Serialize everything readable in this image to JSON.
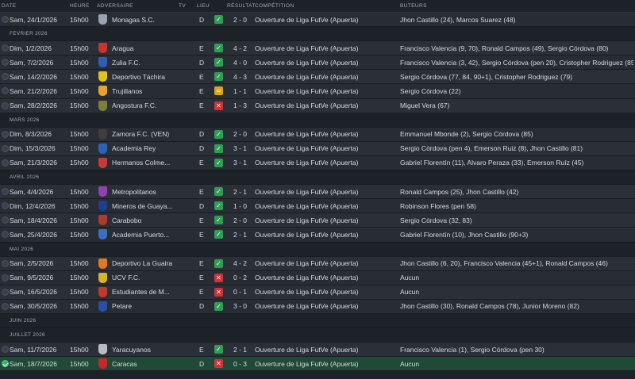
{
  "header": {
    "date": "DATE",
    "time": "HEURE",
    "opponent": "ADVERSAIRE",
    "tv": "TV",
    "venue": "LIEU",
    "result": "RÉSULTAT",
    "competition": "COMPÉTITION",
    "scorers": "BUTEURS"
  },
  "rows": [
    {
      "type": "match",
      "date": "Sam, 24/1/2026",
      "time": "15h00",
      "opponent": "Monagas S.C.",
      "crest_color": "#9aa3b0",
      "venue": "D",
      "result": "W",
      "score": "2 - 0",
      "competition": "Ouverture de Liga FutVe (Apuerta)",
      "scorers": "Jhon Castillo (24), Marcos Suarez (48)",
      "status": "past"
    },
    {
      "type": "month",
      "label": "FÉVRIER 2026"
    },
    {
      "type": "match",
      "date": "Dim, 1/2/2026",
      "time": "15h00",
      "opponent": "Aragua",
      "crest_color": "#c8342e",
      "venue": "E",
      "result": "W",
      "score": "4 - 2",
      "competition": "Ouverture de Liga FutVe (Apuerta)",
      "scorers": "Francisco Valencia (9, 70), Ronald Campos (49), Sergio Córdova (80)",
      "status": "past"
    },
    {
      "type": "match",
      "date": "Sam, 7/2/2026",
      "time": "15h00",
      "opponent": "Zulia F.C.",
      "crest_color": "#2f5fb0",
      "venue": "D",
      "result": "W",
      "score": "4 - 0",
      "competition": "Ouverture de Liga FutVe (Apuerta)",
      "scorers": "Francisco Valencia (3, 42), Sergio Córdova (pen 20), Cristopher Rodriguez (85)",
      "status": "past"
    },
    {
      "type": "match",
      "date": "Sam, 14/2/2026",
      "time": "15h00",
      "opponent": "Deportivo Táchira",
      "crest_color": "#e1c21c",
      "venue": "E",
      "result": "W",
      "score": "4 - 3",
      "competition": "Ouverture de Liga FutVe (Apuerta)",
      "scorers": "Sergio Córdova (77, 84, 90+1), Cristopher Rodriguez (79)",
      "status": "past"
    },
    {
      "type": "match",
      "date": "Sam, 21/2/2026",
      "time": "15h00",
      "opponent": "Trujillanos",
      "crest_color": "#e6a52a",
      "venue": "E",
      "result": "D",
      "score": "1 - 1",
      "competition": "Ouverture de Liga FutVe (Apuerta)",
      "scorers": "Sergio Córdova (22)",
      "status": "past"
    },
    {
      "type": "match",
      "date": "Sam, 28/2/2026",
      "time": "15h00",
      "opponent": "Angostura F.C.",
      "crest_color": "#7a7f3a",
      "venue": "E",
      "result": "L",
      "score": "1 - 3",
      "competition": "Ouverture de Liga FutVe (Apuerta)",
      "scorers": "Miguel Vera (67)",
      "status": "past"
    },
    {
      "type": "month",
      "label": "MARS 2026"
    },
    {
      "type": "match",
      "date": "Dim, 8/3/2026",
      "time": "15h00",
      "opponent": "Zamora F.C. (VEN)",
      "crest_color": "#3e3e3e",
      "venue": "D",
      "result": "W",
      "score": "2 - 0",
      "competition": "Ouverture de Liga FutVe (Apuerta)",
      "scorers": "Emmanuel Mbonde (2), Sergio Córdova (85)",
      "status": "past"
    },
    {
      "type": "match",
      "date": "Dim, 15/3/2026",
      "time": "15h00",
      "opponent": "Academia Rey",
      "crest_color": "#2c63b8",
      "venue": "D",
      "result": "W",
      "score": "3 - 1",
      "competition": "Ouverture de Liga FutVe (Apuerta)",
      "scorers": "Sergio Córdova (pen 4), Emerson Ruiz (8), Jhon Castillo (81)",
      "status": "past"
    },
    {
      "type": "match",
      "date": "Sam, 21/3/2026",
      "time": "15h00",
      "opponent": "Hermanos Colme...",
      "crest_color": "#c83a3a",
      "venue": "E",
      "result": "W",
      "score": "3 - 1",
      "competition": "Ouverture de Liga FutVe (Apuerta)",
      "scorers": "Gabriel Florentín (11), Alvaro Peraza (33), Emerson Ruíz (45)",
      "status": "past"
    },
    {
      "type": "month",
      "label": "AVRIL 2026"
    },
    {
      "type": "match",
      "date": "Sam, 4/4/2026",
      "time": "15h00",
      "opponent": "Metropolitanos",
      "crest_color": "#8e44ad",
      "venue": "E",
      "result": "W",
      "score": "2 - 1",
      "competition": "Ouverture de Liga FutVe (Apuerta)",
      "scorers": "Ronald Campos (25), Jhon Castillo (42)",
      "status": "past"
    },
    {
      "type": "match",
      "date": "Dim, 12/4/2026",
      "time": "15h00",
      "opponent": "Mineros de Guaya...",
      "crest_color": "#1f3f8a",
      "venue": "D",
      "result": "W",
      "score": "1 - 0",
      "competition": "Ouverture de Liga FutVe (Apuerta)",
      "scorers": "Robinson Flores (pen 58)",
      "status": "past"
    },
    {
      "type": "match",
      "date": "Sam, 18/4/2026",
      "time": "15h00",
      "opponent": "Carabobo",
      "crest_color": "#b03a2e",
      "venue": "E",
      "result": "W",
      "score": "2 - 0",
      "competition": "Ouverture de Liga FutVe (Apuerta)",
      "scorers": "Sergio Córdova (32, 83)",
      "status": "past"
    },
    {
      "type": "match",
      "date": "Sam, 25/4/2026",
      "time": "15h00",
      "opponent": "Academia Puerto...",
      "crest_color": "#3a6fc4",
      "venue": "E",
      "result": "W",
      "score": "2 - 1",
      "competition": "Ouverture de Liga FutVe (Apuerta)",
      "scorers": "Gabriel Florentín (10), Jhon Castillo (90+3)",
      "status": "past"
    },
    {
      "type": "month",
      "label": "MAI 2026"
    },
    {
      "type": "match",
      "date": "Sam, 2/5/2026",
      "time": "15h00",
      "opponent": "Deportivo La Guaira",
      "crest_color": "#e07a1f",
      "venue": "E",
      "result": "W",
      "score": "4 - 2",
      "competition": "Ouverture de Liga FutVe (Apuerta)",
      "scorers": "Jhon Castillo (6, 20), Francisco Valencia (45+1), Ronald Campos (46)",
      "status": "past"
    },
    {
      "type": "match",
      "date": "Sam, 9/5/2026",
      "time": "15h00",
      "opponent": "UCV F.C.",
      "crest_color": "#d4b42a",
      "venue": "E",
      "result": "L",
      "score": "0 - 2",
      "competition": "Ouverture de Liga FutVe (Apuerta)",
      "scorers": "Aucun",
      "status": "past"
    },
    {
      "type": "match",
      "date": "Sam, 16/5/2026",
      "time": "15h00",
      "opponent": "Estudiantes de M...",
      "crest_color": "#c0392b",
      "venue": "E",
      "result": "L",
      "score": "0 - 1",
      "competition": "Ouverture de Liga FutVe (Apuerta)",
      "scorers": "Aucun",
      "status": "past"
    },
    {
      "type": "match",
      "date": "Sam, 30/5/2026",
      "time": "15h00",
      "opponent": "Petare",
      "crest_color": "#2b4fa8",
      "venue": "D",
      "result": "W",
      "score": "3 - 0",
      "competition": "Ouverture de Liga FutVe (Apuerta)",
      "scorers": "Jhon Castillo (30), Ronald Campos (78), Junior Moreno (82)",
      "status": "past"
    },
    {
      "type": "month",
      "label": "JUIN 2026"
    },
    {
      "type": "month",
      "label": "JUILLET 2026"
    },
    {
      "type": "match",
      "date": "Sam, 11/7/2026",
      "time": "15h00",
      "opponent": "Yaracuyanos",
      "crest_color": "#b9bcc2",
      "venue": "E",
      "result": "W",
      "score": "2 - 1",
      "competition": "Ouverture de Liga FutVe (Apuerta)",
      "scorers": "Francisco Valencia (1), Sergio Córdova (pen 30)",
      "status": "past"
    },
    {
      "type": "match",
      "date": "Sam, 18/7/2026",
      "time": "15h00",
      "opponent": "Caracas",
      "crest_color": "#c62828",
      "venue": "D",
      "result": "L",
      "score": "0 - 3",
      "competition": "Ouverture de Liga FutVe (Apuerta)",
      "scorers": "Aucun",
      "status": "done",
      "highlight": true
    }
  ],
  "result_colors": {
    "W": "#2f9e54",
    "D": "#d8a51c",
    "L": "#d0323a"
  },
  "result_icons": {
    "W": "check-icon",
    "D": "equals-icon",
    "L": "cross-icon"
  }
}
